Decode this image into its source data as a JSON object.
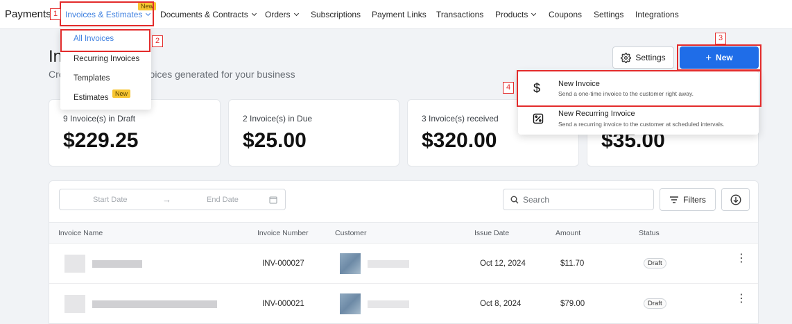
{
  "nav": {
    "brand": "Payments",
    "items": [
      {
        "label": "Invoices & Estimates",
        "dropdown": true,
        "active": true,
        "badge": "New"
      },
      {
        "label": "Documents & Contracts",
        "dropdown": true
      },
      {
        "label": "Orders",
        "dropdown": true
      },
      {
        "label": "Subscriptions"
      },
      {
        "label": "Payment Links"
      },
      {
        "label": "Transactions"
      },
      {
        "label": "Products",
        "dropdown": true
      },
      {
        "label": "Coupons"
      },
      {
        "label": "Settings"
      },
      {
        "label": "Integrations"
      }
    ]
  },
  "invoices_menu": {
    "items": [
      {
        "label": "All Invoices",
        "selected": true
      },
      {
        "label": "Recurring Invoices"
      },
      {
        "label": "Templates"
      },
      {
        "label": "Estimates",
        "badge": "New"
      }
    ]
  },
  "header": {
    "title": "Invoices",
    "subtitle": "Create and manage invoices generated for your business",
    "settings_label": "Settings",
    "new_label": "New"
  },
  "new_menu": {
    "items": [
      {
        "title": "New Invoice",
        "desc": "Send a one-time invoice to the customer right away.",
        "icon": "dollar-icon"
      },
      {
        "title": "New Recurring Invoice",
        "desc": "Send a recurring invoice to the customer at scheduled intervals.",
        "icon": "recurring-invoice-icon"
      }
    ]
  },
  "stats": [
    {
      "label": "9 Invoice(s) in Draft",
      "value": "$229.25"
    },
    {
      "label": "2 Invoice(s) in Due",
      "value": "$25.00"
    },
    {
      "label": "3 Invoice(s) received",
      "value": "$320.00"
    },
    {
      "label": "",
      "value": "$35.00"
    }
  ],
  "filters": {
    "start_placeholder": "Start Date",
    "end_placeholder": "End Date",
    "search_placeholder": "Search",
    "filters_label": "Filters"
  },
  "table": {
    "columns": [
      "Invoice Name",
      "Invoice Number",
      "Customer",
      "Issue Date",
      "Amount",
      "Status"
    ],
    "rows": [
      {
        "number": "INV-000027",
        "date": "Oct 12, 2024",
        "amount": "$11.70",
        "status": "Draft"
      },
      {
        "number": "INV-000021",
        "date": "Oct 8, 2024",
        "amount": "$79.00",
        "status": "Draft"
      }
    ]
  },
  "annotations": [
    "1",
    "2",
    "3",
    "4"
  ],
  "colors": {
    "accent": "#1f6de8",
    "link": "#3d7fe0",
    "highlight": "#e32b2b",
    "badge": "#f7c531"
  }
}
